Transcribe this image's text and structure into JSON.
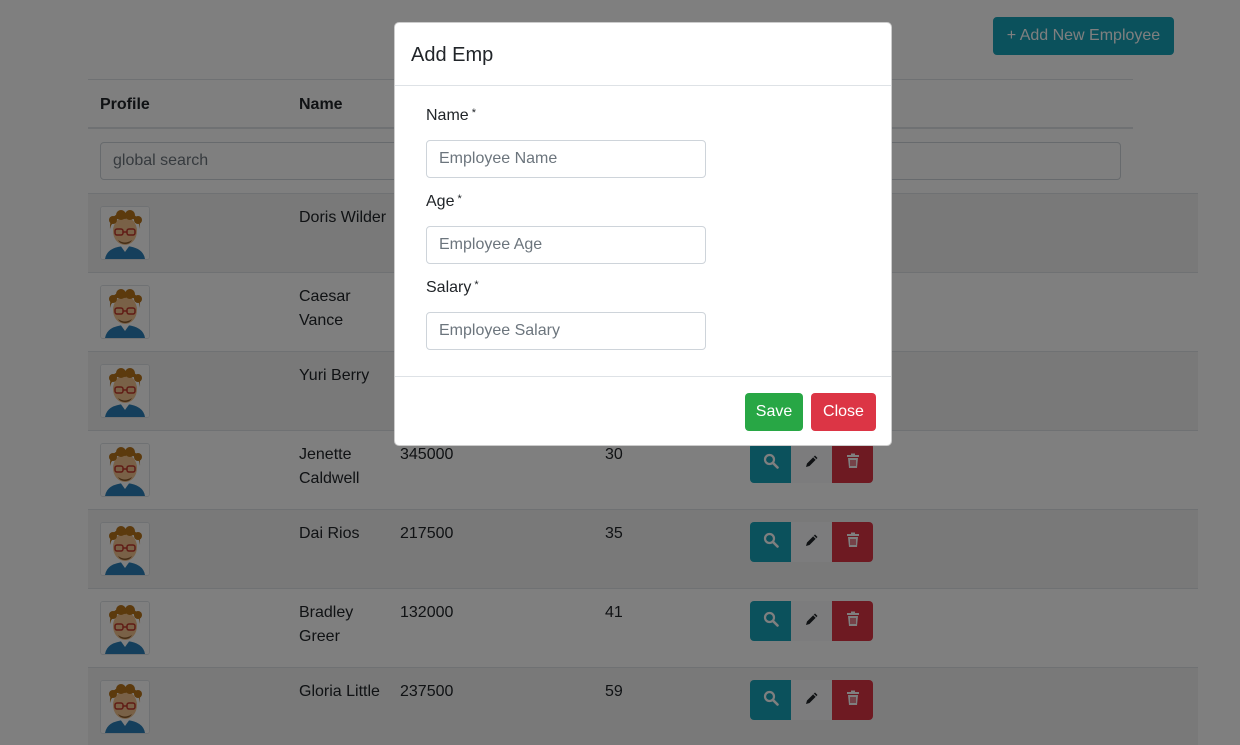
{
  "toolbar": {
    "add_label": "+ Add New Employee"
  },
  "table": {
    "headers": {
      "profile": "Profile",
      "name": "Name"
    },
    "search_placeholder": "global search",
    "rows": [
      {
        "name": "Doris Wilder",
        "salary": "",
        "age": ""
      },
      {
        "name": "Caesar Vance",
        "salary": "",
        "age": ""
      },
      {
        "name": "Yuri Berry",
        "salary": "",
        "age": ""
      },
      {
        "name": "Jenette Caldwell",
        "salary": "345000",
        "age": "30"
      },
      {
        "name": "Dai Rios",
        "salary": "217500",
        "age": "35"
      },
      {
        "name": "Bradley Greer",
        "salary": "132000",
        "age": "41"
      },
      {
        "name": "Gloria Little",
        "salary": "237500",
        "age": "59"
      }
    ]
  },
  "modal": {
    "title": "Add Emp",
    "fields": [
      {
        "label": "Name",
        "required_mark": "*",
        "placeholder": "Employee Name",
        "value": ""
      },
      {
        "label": "Age",
        "required_mark": "*",
        "placeholder": "Employee Age",
        "value": ""
      },
      {
        "label": "Salary",
        "required_mark": "*",
        "placeholder": "Employee Salary",
        "value": ""
      }
    ],
    "save_label": "Save",
    "close_label": "Close"
  },
  "icons": {
    "view": "search-icon",
    "edit": "pencil-icon",
    "delete": "trash-icon",
    "avatar": "avatar-cartoon-icon"
  },
  "colors": {
    "primary_info": "#17a2b8",
    "success": "#28a745",
    "danger": "#dc3545",
    "light": "#f8f9fa"
  }
}
